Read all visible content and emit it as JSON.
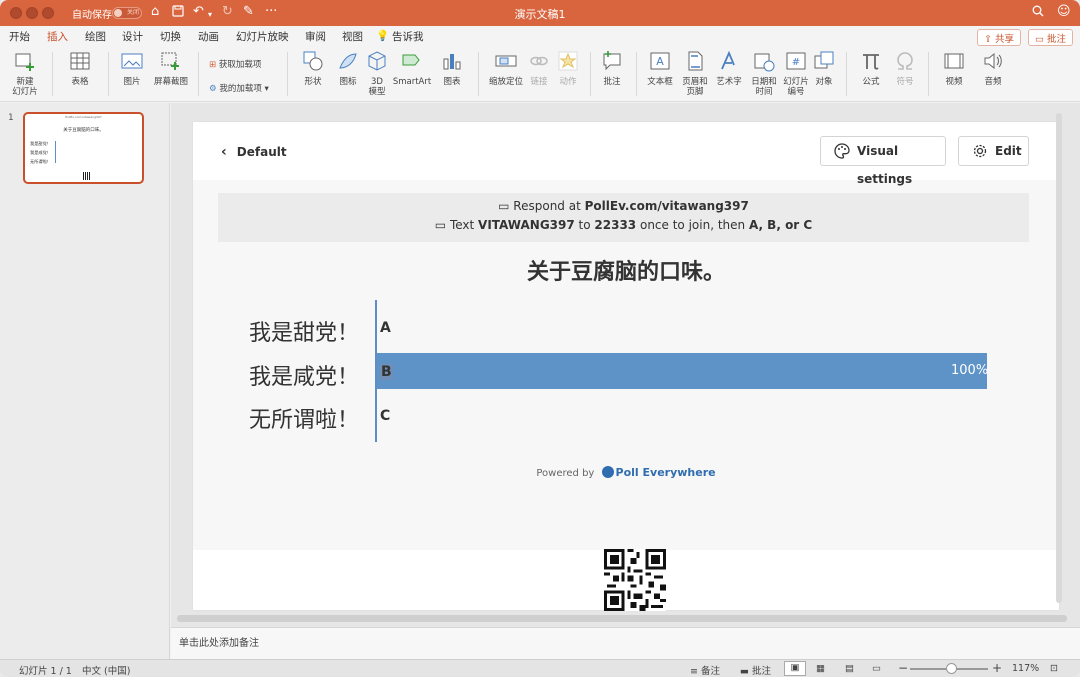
{
  "titlebar": {
    "autosave": "自动保存",
    "autosave_state": "关闭",
    "doc_title": "演示文稿1"
  },
  "menu": {
    "tabs": [
      "开始",
      "插入",
      "绘图",
      "设计",
      "切换",
      "动画",
      "幻灯片放映",
      "审阅",
      "视图",
      "告诉我"
    ],
    "active": "插入",
    "share": "共享",
    "comments": "批注"
  },
  "ribbon": {
    "new_slide": "新建\n幻灯片",
    "table": "表格",
    "picture": "图片",
    "screenshot": "屏幕截图",
    "get_addins": "获取加载项",
    "my_addins": "我的加载项",
    "shapes": "形状",
    "icons": "图标",
    "model3d": "3D\n模型",
    "smartart": "SmartArt",
    "chart": "图表",
    "zoom": "缩放定位",
    "link": "链接",
    "action": "动作",
    "comment": "批注",
    "textbox": "文本框",
    "header_footer": "页眉和\n页脚",
    "wordart": "艺术字",
    "datetime": "日期和\n时间",
    "slide_number": "幻灯片\n编号",
    "object": "对象",
    "equation": "公式",
    "symbol": "符号",
    "video": "视频",
    "audio": "音频"
  },
  "thumbnail": {
    "number": "1",
    "title": "关于豆腐脑的口味。",
    "options": [
      "我是甜党！",
      "我是咸党！",
      "无所谓啦！"
    ]
  },
  "poll": {
    "back_label": "Default",
    "visual_settings": "Visual settings",
    "edit": "Edit",
    "respond_prefix": "Respond at ",
    "respond_url": "PollEv.com/vitawang397",
    "text_prefix": "Text ",
    "text_code": "VITAWANG397",
    "text_to": " to ",
    "text_number": "22333",
    "text_middle": " once to join, then ",
    "text_choices": "A, B, or C",
    "title": "关于豆腐脑的口味。",
    "options": [
      {
        "label": "我是甜党！",
        "letter": "A",
        "percent": 0,
        "pct_label": ""
      },
      {
        "label": "我是咸党！",
        "letter": "B",
        "percent": 100,
        "pct_label": "100%"
      },
      {
        "label": "无所谓啦！",
        "letter": "C",
        "percent": 0,
        "pct_label": ""
      }
    ],
    "powered_by": "Powered by",
    "brand": "Poll Everywhere"
  },
  "notes": {
    "placeholder": "单击此处添加备注"
  },
  "status": {
    "slide": "幻灯片 1 / 1",
    "language": "中文 (中国)",
    "notes": "备注",
    "comments": "批注",
    "zoom": "117%"
  },
  "colors": {
    "accent": "#d9653f",
    "bar": "#5e93c8"
  }
}
